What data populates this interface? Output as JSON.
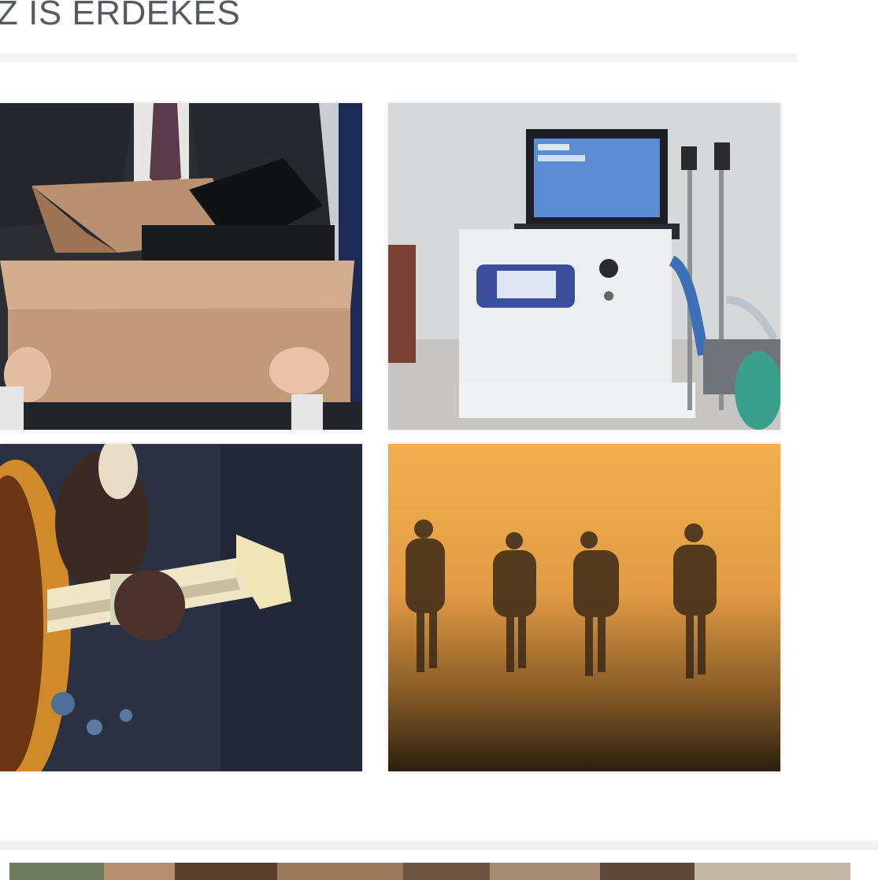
{
  "section": {
    "title": "Z IS ÉRDEKES"
  },
  "articles": [
    {
      "image_icon": "office-worker-box-photo"
    },
    {
      "image_icon": "medical-ventilator-photo"
    },
    {
      "image_icon": "bass-guitar-photo"
    },
    {
      "image_icon": "people-walking-fog-photo"
    }
  ],
  "next_section": {
    "image_icon": "crowd-banner-photo"
  },
  "colors": {
    "title": "#555b60",
    "divider": "#f3f3f3",
    "fog_orange": "#e8a24a",
    "dark_navy": "#232a3a"
  }
}
